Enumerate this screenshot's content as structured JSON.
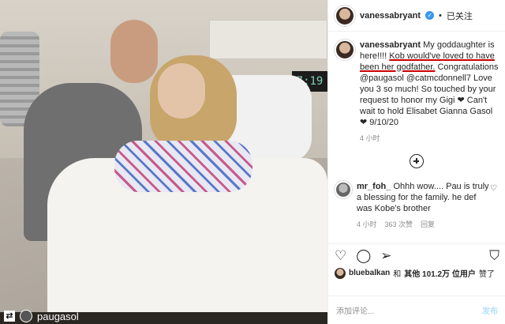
{
  "photo": {
    "clock_text": "7:19",
    "repost_username": "paugasol"
  },
  "header": {
    "username": "vanessabryant",
    "verified_icon": "verified-badge-icon",
    "separator": "•",
    "follow_status": "已关注"
  },
  "caption": {
    "username": "vanessabryant",
    "text_before": " My goddaughter is here!!!! ",
    "underlined": "Kob would've loved to have been her godfather.",
    "text_after": " Congratulations @paugasol @catmcdonnell7 Love you 3 so much! So touched by your request to honor my Gigi ❤ Can't wait to hold Elisabet Gianna Gasol ❤ 9/10/20",
    "time": "4 小时"
  },
  "comment": {
    "username": "mr_foh_",
    "text": " Ohhh wow.... Pau is truly a blessing for the family. he def was Kobe's brother",
    "time": "4 小时",
    "likes": "363 次赞",
    "reply": "回复"
  },
  "actions": {
    "like_icon": "heart-icon",
    "comment_icon": "comment-icon",
    "share_icon": "share-icon",
    "save_icon": "bookmark-icon"
  },
  "likes": {
    "user": "bluebalkan",
    "and": "和",
    "others": "其他 101.2万 位用户",
    "liked": "赞了"
  },
  "add_comment": {
    "placeholder": "添加评论...",
    "post_label": "发布"
  }
}
